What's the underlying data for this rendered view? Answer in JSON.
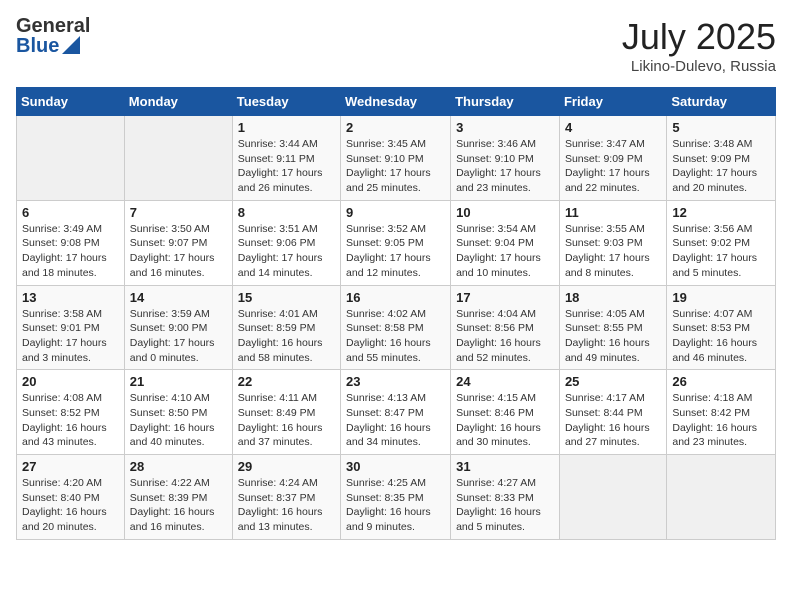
{
  "header": {
    "logo_general": "General",
    "logo_blue": "Blue",
    "title": "July 2025",
    "location": "Likino-Dulevo, Russia"
  },
  "days_of_week": [
    "Sunday",
    "Monday",
    "Tuesday",
    "Wednesday",
    "Thursday",
    "Friday",
    "Saturday"
  ],
  "weeks": [
    [
      {
        "day": "",
        "info": ""
      },
      {
        "day": "",
        "info": ""
      },
      {
        "day": "1",
        "info": "Sunrise: 3:44 AM\nSunset: 9:11 PM\nDaylight: 17 hours and 26 minutes."
      },
      {
        "day": "2",
        "info": "Sunrise: 3:45 AM\nSunset: 9:10 PM\nDaylight: 17 hours and 25 minutes."
      },
      {
        "day": "3",
        "info": "Sunrise: 3:46 AM\nSunset: 9:10 PM\nDaylight: 17 hours and 23 minutes."
      },
      {
        "day": "4",
        "info": "Sunrise: 3:47 AM\nSunset: 9:09 PM\nDaylight: 17 hours and 22 minutes."
      },
      {
        "day": "5",
        "info": "Sunrise: 3:48 AM\nSunset: 9:09 PM\nDaylight: 17 hours and 20 minutes."
      }
    ],
    [
      {
        "day": "6",
        "info": "Sunrise: 3:49 AM\nSunset: 9:08 PM\nDaylight: 17 hours and 18 minutes."
      },
      {
        "day": "7",
        "info": "Sunrise: 3:50 AM\nSunset: 9:07 PM\nDaylight: 17 hours and 16 minutes."
      },
      {
        "day": "8",
        "info": "Sunrise: 3:51 AM\nSunset: 9:06 PM\nDaylight: 17 hours and 14 minutes."
      },
      {
        "day": "9",
        "info": "Sunrise: 3:52 AM\nSunset: 9:05 PM\nDaylight: 17 hours and 12 minutes."
      },
      {
        "day": "10",
        "info": "Sunrise: 3:54 AM\nSunset: 9:04 PM\nDaylight: 17 hours and 10 minutes."
      },
      {
        "day": "11",
        "info": "Sunrise: 3:55 AM\nSunset: 9:03 PM\nDaylight: 17 hours and 8 minutes."
      },
      {
        "day": "12",
        "info": "Sunrise: 3:56 AM\nSunset: 9:02 PM\nDaylight: 17 hours and 5 minutes."
      }
    ],
    [
      {
        "day": "13",
        "info": "Sunrise: 3:58 AM\nSunset: 9:01 PM\nDaylight: 17 hours and 3 minutes."
      },
      {
        "day": "14",
        "info": "Sunrise: 3:59 AM\nSunset: 9:00 PM\nDaylight: 17 hours and 0 minutes."
      },
      {
        "day": "15",
        "info": "Sunrise: 4:01 AM\nSunset: 8:59 PM\nDaylight: 16 hours and 58 minutes."
      },
      {
        "day": "16",
        "info": "Sunrise: 4:02 AM\nSunset: 8:58 PM\nDaylight: 16 hours and 55 minutes."
      },
      {
        "day": "17",
        "info": "Sunrise: 4:04 AM\nSunset: 8:56 PM\nDaylight: 16 hours and 52 minutes."
      },
      {
        "day": "18",
        "info": "Sunrise: 4:05 AM\nSunset: 8:55 PM\nDaylight: 16 hours and 49 minutes."
      },
      {
        "day": "19",
        "info": "Sunrise: 4:07 AM\nSunset: 8:53 PM\nDaylight: 16 hours and 46 minutes."
      }
    ],
    [
      {
        "day": "20",
        "info": "Sunrise: 4:08 AM\nSunset: 8:52 PM\nDaylight: 16 hours and 43 minutes."
      },
      {
        "day": "21",
        "info": "Sunrise: 4:10 AM\nSunset: 8:50 PM\nDaylight: 16 hours and 40 minutes."
      },
      {
        "day": "22",
        "info": "Sunrise: 4:11 AM\nSunset: 8:49 PM\nDaylight: 16 hours and 37 minutes."
      },
      {
        "day": "23",
        "info": "Sunrise: 4:13 AM\nSunset: 8:47 PM\nDaylight: 16 hours and 34 minutes."
      },
      {
        "day": "24",
        "info": "Sunrise: 4:15 AM\nSunset: 8:46 PM\nDaylight: 16 hours and 30 minutes."
      },
      {
        "day": "25",
        "info": "Sunrise: 4:17 AM\nSunset: 8:44 PM\nDaylight: 16 hours and 27 minutes."
      },
      {
        "day": "26",
        "info": "Sunrise: 4:18 AM\nSunset: 8:42 PM\nDaylight: 16 hours and 23 minutes."
      }
    ],
    [
      {
        "day": "27",
        "info": "Sunrise: 4:20 AM\nSunset: 8:40 PM\nDaylight: 16 hours and 20 minutes."
      },
      {
        "day": "28",
        "info": "Sunrise: 4:22 AM\nSunset: 8:39 PM\nDaylight: 16 hours and 16 minutes."
      },
      {
        "day": "29",
        "info": "Sunrise: 4:24 AM\nSunset: 8:37 PM\nDaylight: 16 hours and 13 minutes."
      },
      {
        "day": "30",
        "info": "Sunrise: 4:25 AM\nSunset: 8:35 PM\nDaylight: 16 hours and 9 minutes."
      },
      {
        "day": "31",
        "info": "Sunrise: 4:27 AM\nSunset: 8:33 PM\nDaylight: 16 hours and 5 minutes."
      },
      {
        "day": "",
        "info": ""
      },
      {
        "day": "",
        "info": ""
      }
    ]
  ]
}
